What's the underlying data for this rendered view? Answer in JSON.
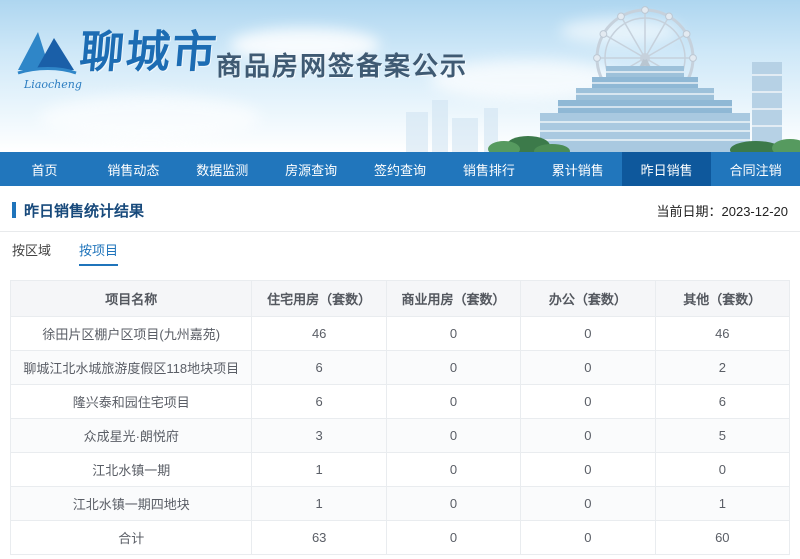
{
  "header": {
    "site_name": "聊城市",
    "logo_script": "Liaocheng",
    "title": "商品房网签备案公示"
  },
  "nav": {
    "items": [
      {
        "label": "首页",
        "active": false
      },
      {
        "label": "销售动态",
        "active": false
      },
      {
        "label": "数据监测",
        "active": false
      },
      {
        "label": "房源查询",
        "active": false
      },
      {
        "label": "签约查询",
        "active": false
      },
      {
        "label": "销售排行",
        "active": false
      },
      {
        "label": "累计销售",
        "active": false
      },
      {
        "label": "昨日销售",
        "active": true
      },
      {
        "label": "合同注销",
        "active": false
      }
    ]
  },
  "page": {
    "title": "昨日销售统计结果",
    "date_label": "当前日期：",
    "date_value": "2023-12-20"
  },
  "tabs": [
    {
      "label": "按区域",
      "active": false
    },
    {
      "label": "按项目",
      "active": true
    }
  ],
  "table": {
    "columns": [
      "项目名称",
      "住宅用房（套数）",
      "商业用房（套数）",
      "办公（套数）",
      "其他（套数）"
    ],
    "rows": [
      [
        "徐田片区棚户区项目(九州嘉苑)",
        "46",
        "0",
        "0",
        "46"
      ],
      [
        "聊城江北水城旅游度假区118地块项目",
        "6",
        "0",
        "0",
        "2"
      ],
      [
        "隆兴泰和园住宅项目",
        "6",
        "0",
        "0",
        "6"
      ],
      [
        "众成星光·朗悦府",
        "3",
        "0",
        "0",
        "5"
      ],
      [
        "江北水镇一期",
        "1",
        "0",
        "0",
        "0"
      ],
      [
        "江北水镇一期四地块",
        "1",
        "0",
        "0",
        "1"
      ],
      [
        "合计",
        "63",
        "0",
        "0",
        "60"
      ]
    ]
  },
  "theme": {
    "accent_blue": "#1f74bb",
    "nav_bg": "#2176bc",
    "nav_active_bg": "#0e589c"
  }
}
